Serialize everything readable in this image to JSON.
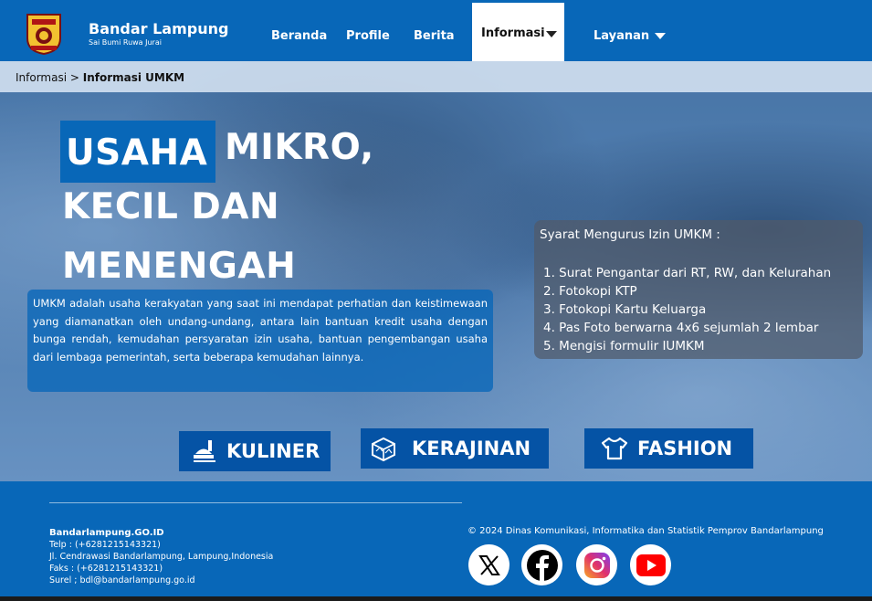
{
  "header": {
    "brand_title": "Bandar Lampung",
    "brand_subtitle": "Sai Bumi Ruwa Jurai",
    "nav": {
      "beranda": "Beranda",
      "profile": "Profile",
      "berita": "Berita",
      "informasi": "Informasi",
      "layanan": "Layanan"
    },
    "active_nav": "Informasi"
  },
  "breadcrumb": {
    "parent": "Informasi",
    "separator": " > ",
    "current": "Informasi UMKM"
  },
  "hero": {
    "title_highlight": "USAHA",
    "title_line1_rest": "MIKRO,",
    "title_line2": "KECIL DAN",
    "title_line3": "MENENGAH",
    "description": "UMKM adalah usaha kerakyatan yang saat ini mendapat perhatian dan keistimewaan yang diamanatkan oleh undang-undang, antara lain bantuan kredit usaha dengan bunga rendah, kemudahan persyaratan izin usaha, bantuan pengembangan usaha dari lembaga pemerintah, serta beberapa kemudahan lainnya."
  },
  "requirements": {
    "title": "Syarat Mengurus Izin UMKM  :",
    "items": [
      "1.  Surat Pengantar dari RT, RW, dan Kelurahan",
      "2.  Fotokopi KTP",
      "3.  Fotokopi Kartu Keluarga",
      "4.  Pas Foto berwarna 4x6 sejumlah 2 lembar",
      "5.  Mengisi formulir IUMKM"
    ]
  },
  "categories": {
    "kuliner": "KULINER",
    "kerajinan": "KERAJINAN",
    "fashion": "FASHION"
  },
  "footer": {
    "site": "Bandarlampung.GO.ID",
    "telp": "Telp : (+6281215143321)",
    "address": "Jl. Cendrawasi Bandarlampung, Lampung,Indonesia",
    "faks": "Faks : (+6281215143321)",
    "surel": "Surel  ; bdl@bandarlampung.go.id",
    "copyright": "© 2024 Dinas Komunikasi, Informatika dan Statistik Pemprov Bandarlampung"
  },
  "colors": {
    "primary": "#0867b8",
    "category_button": "#0553a5",
    "youtube": "#ff0000",
    "facebook": "#000000"
  },
  "icons": [
    "city-logo-icon",
    "caret-down-icon",
    "kuliner-icon",
    "kerajinan-icon",
    "fashion-icon",
    "x-twitter-icon",
    "facebook-icon",
    "instagram-icon",
    "youtube-icon"
  ]
}
